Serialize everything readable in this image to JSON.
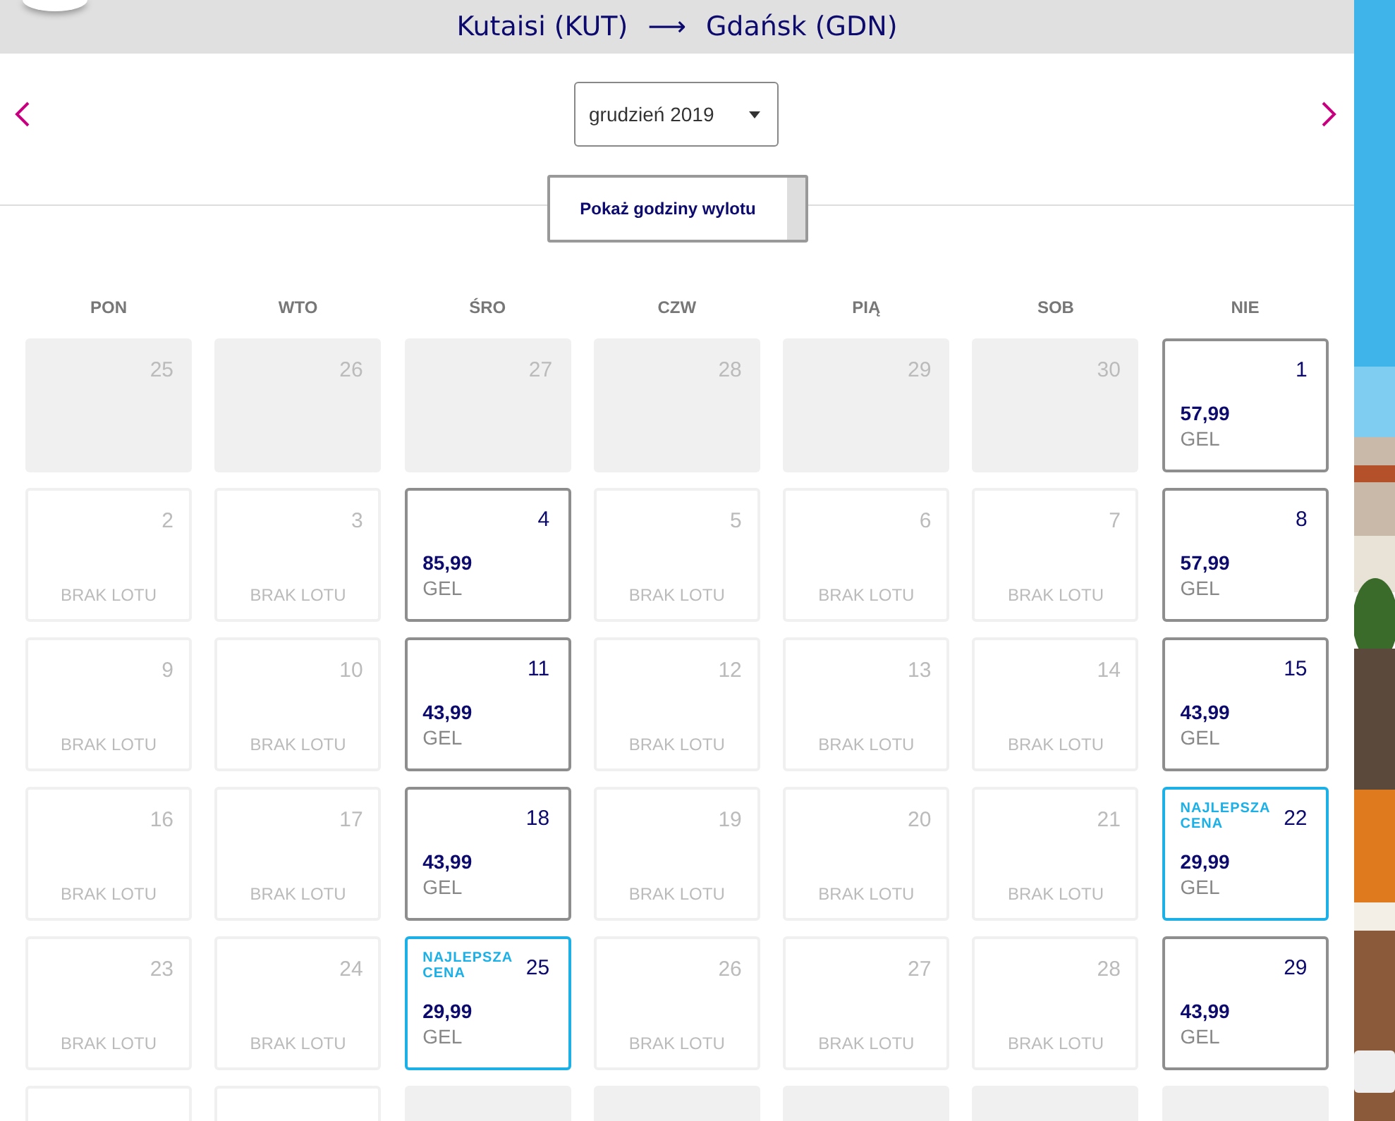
{
  "header": {
    "origin": "Kutaisi (KUT)",
    "arrow": "⟶",
    "destination": "Gdańsk (GDN)"
  },
  "month_select": {
    "value": "grudzień 2019"
  },
  "toggle_button": {
    "label": "Pokaż godziny wylotu"
  },
  "weekdays": [
    "PON",
    "WTO",
    "ŚRO",
    "CZW",
    "PIĄ",
    "SOB",
    "NIE"
  ],
  "days": [
    {
      "kind": "other",
      "day": "25"
    },
    {
      "kind": "other",
      "day": "26"
    },
    {
      "kind": "other",
      "day": "27"
    },
    {
      "kind": "other",
      "day": "28"
    },
    {
      "kind": "other",
      "day": "29"
    },
    {
      "kind": "other",
      "day": "30"
    },
    {
      "kind": "flight",
      "day": "1",
      "price": "57,99",
      "currency": "GEL"
    },
    {
      "kind": "none",
      "day": "2",
      "note": "BRAK LOTU"
    },
    {
      "kind": "none",
      "day": "3",
      "note": "BRAK LOTU"
    },
    {
      "kind": "flight",
      "day": "4",
      "price": "85,99",
      "currency": "GEL"
    },
    {
      "kind": "none",
      "day": "5",
      "note": "BRAK LOTU"
    },
    {
      "kind": "none",
      "day": "6",
      "note": "BRAK LOTU"
    },
    {
      "kind": "none",
      "day": "7",
      "note": "BRAK LOTU"
    },
    {
      "kind": "flight",
      "day": "8",
      "price": "57,99",
      "currency": "GEL"
    },
    {
      "kind": "none",
      "day": "9",
      "note": "BRAK LOTU"
    },
    {
      "kind": "none",
      "day": "10",
      "note": "BRAK LOTU"
    },
    {
      "kind": "flight",
      "day": "11",
      "price": "43,99",
      "currency": "GEL"
    },
    {
      "kind": "none",
      "day": "12",
      "note": "BRAK LOTU"
    },
    {
      "kind": "none",
      "day": "13",
      "note": "BRAK LOTU"
    },
    {
      "kind": "none",
      "day": "14",
      "note": "BRAK LOTU"
    },
    {
      "kind": "flight",
      "day": "15",
      "price": "43,99",
      "currency": "GEL"
    },
    {
      "kind": "none",
      "day": "16",
      "note": "BRAK LOTU"
    },
    {
      "kind": "none",
      "day": "17",
      "note": "BRAK LOTU"
    },
    {
      "kind": "flight",
      "day": "18",
      "price": "43,99",
      "currency": "GEL"
    },
    {
      "kind": "none",
      "day": "19",
      "note": "BRAK LOTU"
    },
    {
      "kind": "none",
      "day": "20",
      "note": "BRAK LOTU"
    },
    {
      "kind": "none",
      "day": "21",
      "note": "BRAK LOTU"
    },
    {
      "kind": "best",
      "day": "22",
      "badge": "NAJLEPSZA CENA",
      "price": "29,99",
      "currency": "GEL"
    },
    {
      "kind": "none",
      "day": "23",
      "note": "BRAK LOTU"
    },
    {
      "kind": "none",
      "day": "24",
      "note": "BRAK LOTU"
    },
    {
      "kind": "best",
      "day": "25",
      "badge": "NAJLEPSZA CENA",
      "price": "29,99",
      "currency": "GEL"
    },
    {
      "kind": "none",
      "day": "26",
      "note": "BRAK LOTU"
    },
    {
      "kind": "none",
      "day": "27",
      "note": "BRAK LOTU"
    },
    {
      "kind": "none",
      "day": "28",
      "note": "BRAK LOTU"
    },
    {
      "kind": "flight",
      "day": "29",
      "price": "43,99",
      "currency": "GEL"
    },
    {
      "kind": "none"
    },
    {
      "kind": "none"
    },
    {
      "kind": "other"
    },
    {
      "kind": "other"
    },
    {
      "kind": "other"
    },
    {
      "kind": "other"
    },
    {
      "kind": "other"
    }
  ]
}
